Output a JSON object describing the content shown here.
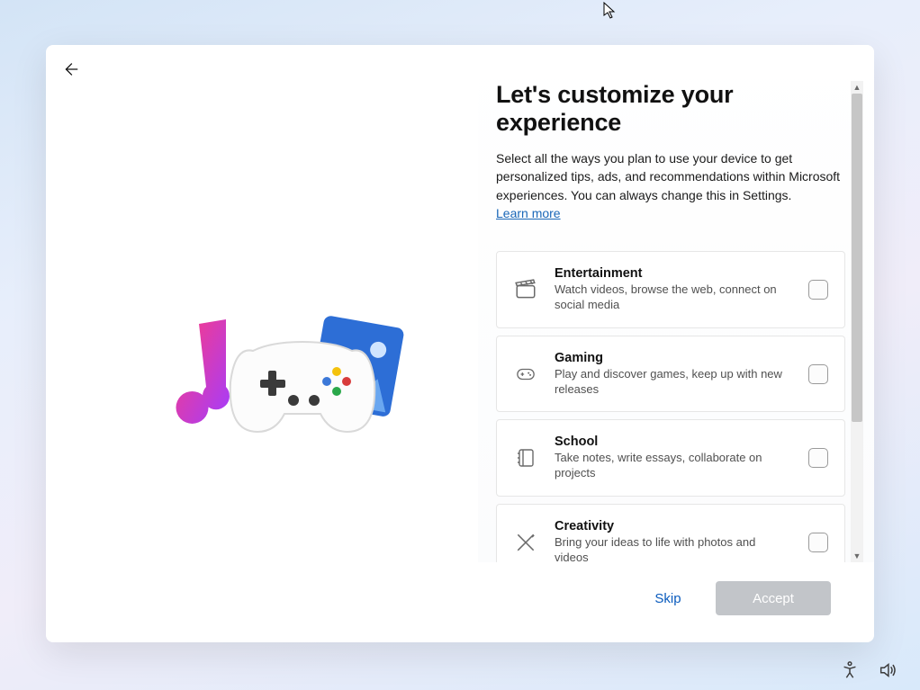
{
  "heading": "Let's customize your experience",
  "subtext": "Select all the ways you plan to use your device to get personalized tips, ads, and recommendations within Microsoft experiences. You can always change this in Settings.",
  "learn_more": "Learn more",
  "options": [
    {
      "key": "entertainment",
      "title": "Entertainment",
      "desc": "Watch videos, browse the web, connect on social media"
    },
    {
      "key": "gaming",
      "title": "Gaming",
      "desc": "Play and discover games, keep up with new releases"
    },
    {
      "key": "school",
      "title": "School",
      "desc": "Take notes, write essays, collaborate on projects"
    },
    {
      "key": "creativity",
      "title": "Creativity",
      "desc": "Bring your ideas to life with photos and videos"
    }
  ],
  "buttons": {
    "skip": "Skip",
    "accept": "Accept"
  },
  "system_icons": {
    "accessibility": "accessibility",
    "volume": "volume"
  }
}
